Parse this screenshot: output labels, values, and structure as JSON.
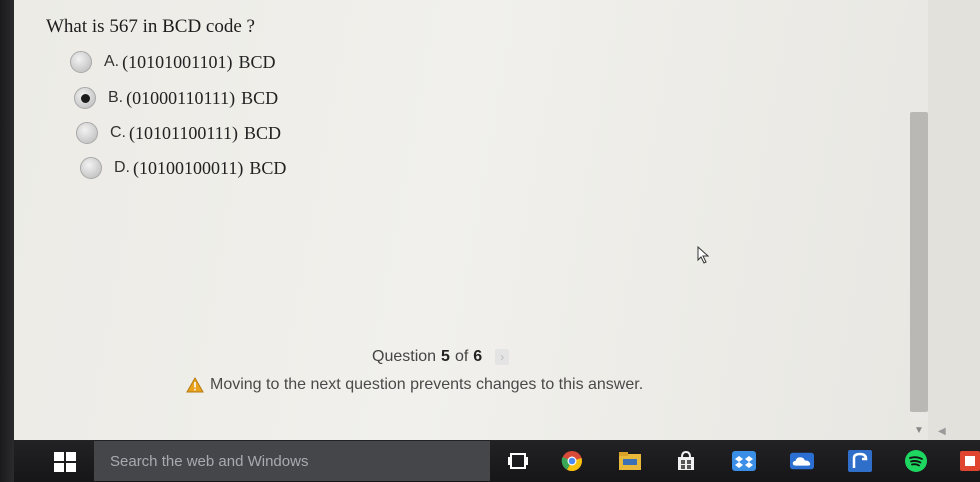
{
  "quiz": {
    "question": "What is 567 in BCD code ?",
    "options": [
      {
        "letter": "A.",
        "code": "(10101001101)",
        "unit": "BCD",
        "selected": false
      },
      {
        "letter": "B.",
        "code": "(01000110111)",
        "unit": "BCD",
        "selected": true
      },
      {
        "letter": "C.",
        "code": "(10101100111)",
        "unit": "BCD",
        "selected": false
      },
      {
        "letter": "D.",
        "code": "(10100100011)",
        "unit": "BCD",
        "selected": false
      }
    ],
    "progress": {
      "label": "Question",
      "current": "5",
      "of": "of",
      "total": "6"
    },
    "warning": "Moving to the next question prevents changes to this answer."
  },
  "taskbar": {
    "search_placeholder": "Search the web and Windows",
    "icons": [
      "windows-start-icon",
      "task-view-icon",
      "chrome-icon",
      "file-explorer-icon",
      "store-icon",
      "dropbox-icon",
      "onedrive-icon",
      "app-icon",
      "spotify-icon",
      "office-icon"
    ]
  },
  "colors": {
    "warning": "#e8a21c",
    "chrome_red": "#d84a3a",
    "chrome_yellow": "#f4c20d",
    "chrome_green": "#3aa757",
    "explorer": "#e8b83a",
    "dropbox": "#3a8ee6",
    "onedrive": "#2a6fd1",
    "spotify": "#1ed760",
    "office": "#e0452f"
  }
}
